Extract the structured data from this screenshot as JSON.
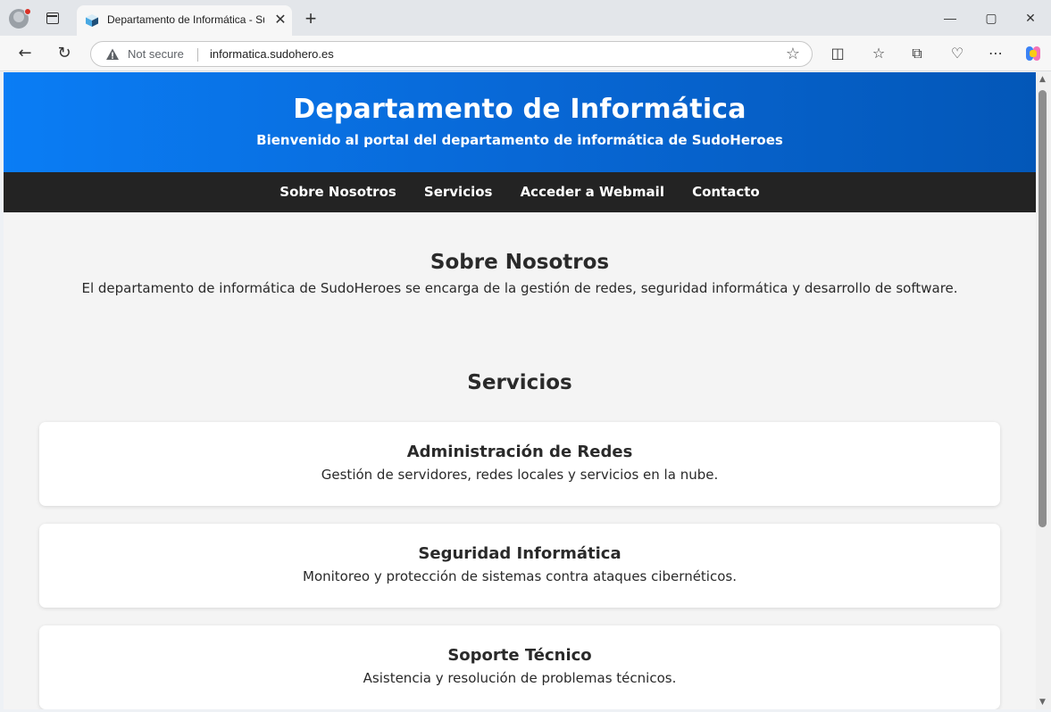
{
  "browser": {
    "tab_title": "Departamento de Informática - SudoHeroes",
    "security_label": "Not secure",
    "url": "informatica.sudohero.es",
    "new_tab_symbol": "+",
    "window_controls": {
      "minimize": "—",
      "maximize": "▢",
      "close": "✕"
    }
  },
  "page": {
    "header": {
      "title": "Departamento de Informática",
      "subtitle": "Bienvenido al portal del departamento de informática de SudoHeroes"
    },
    "nav": [
      {
        "label": "Sobre Nosotros"
      },
      {
        "label": "Servicios"
      },
      {
        "label": "Acceder a Webmail"
      },
      {
        "label": "Contacto"
      }
    ],
    "about": {
      "heading": "Sobre Nosotros",
      "text": "El departamento de informática de SudoHeroes se encarga de la gestión de redes, seguridad informática y desarrollo de software."
    },
    "services": {
      "heading": "Servicios",
      "items": [
        {
          "title": "Administración de Redes",
          "description": "Gestión de servidores, redes locales y servicios en la nube."
        },
        {
          "title": "Seguridad Informática",
          "description": "Monitoreo y protección de sistemas contra ataques cibernéticos."
        },
        {
          "title": "Soporte Técnico",
          "description": "Asistencia y resolución de problemas técnicos."
        }
      ]
    }
  },
  "colors": {
    "header_gradient_start": "#0a7df5",
    "header_gradient_end": "#0357b8",
    "nav_bg": "#232323",
    "page_bg": "#f4f4f4"
  }
}
